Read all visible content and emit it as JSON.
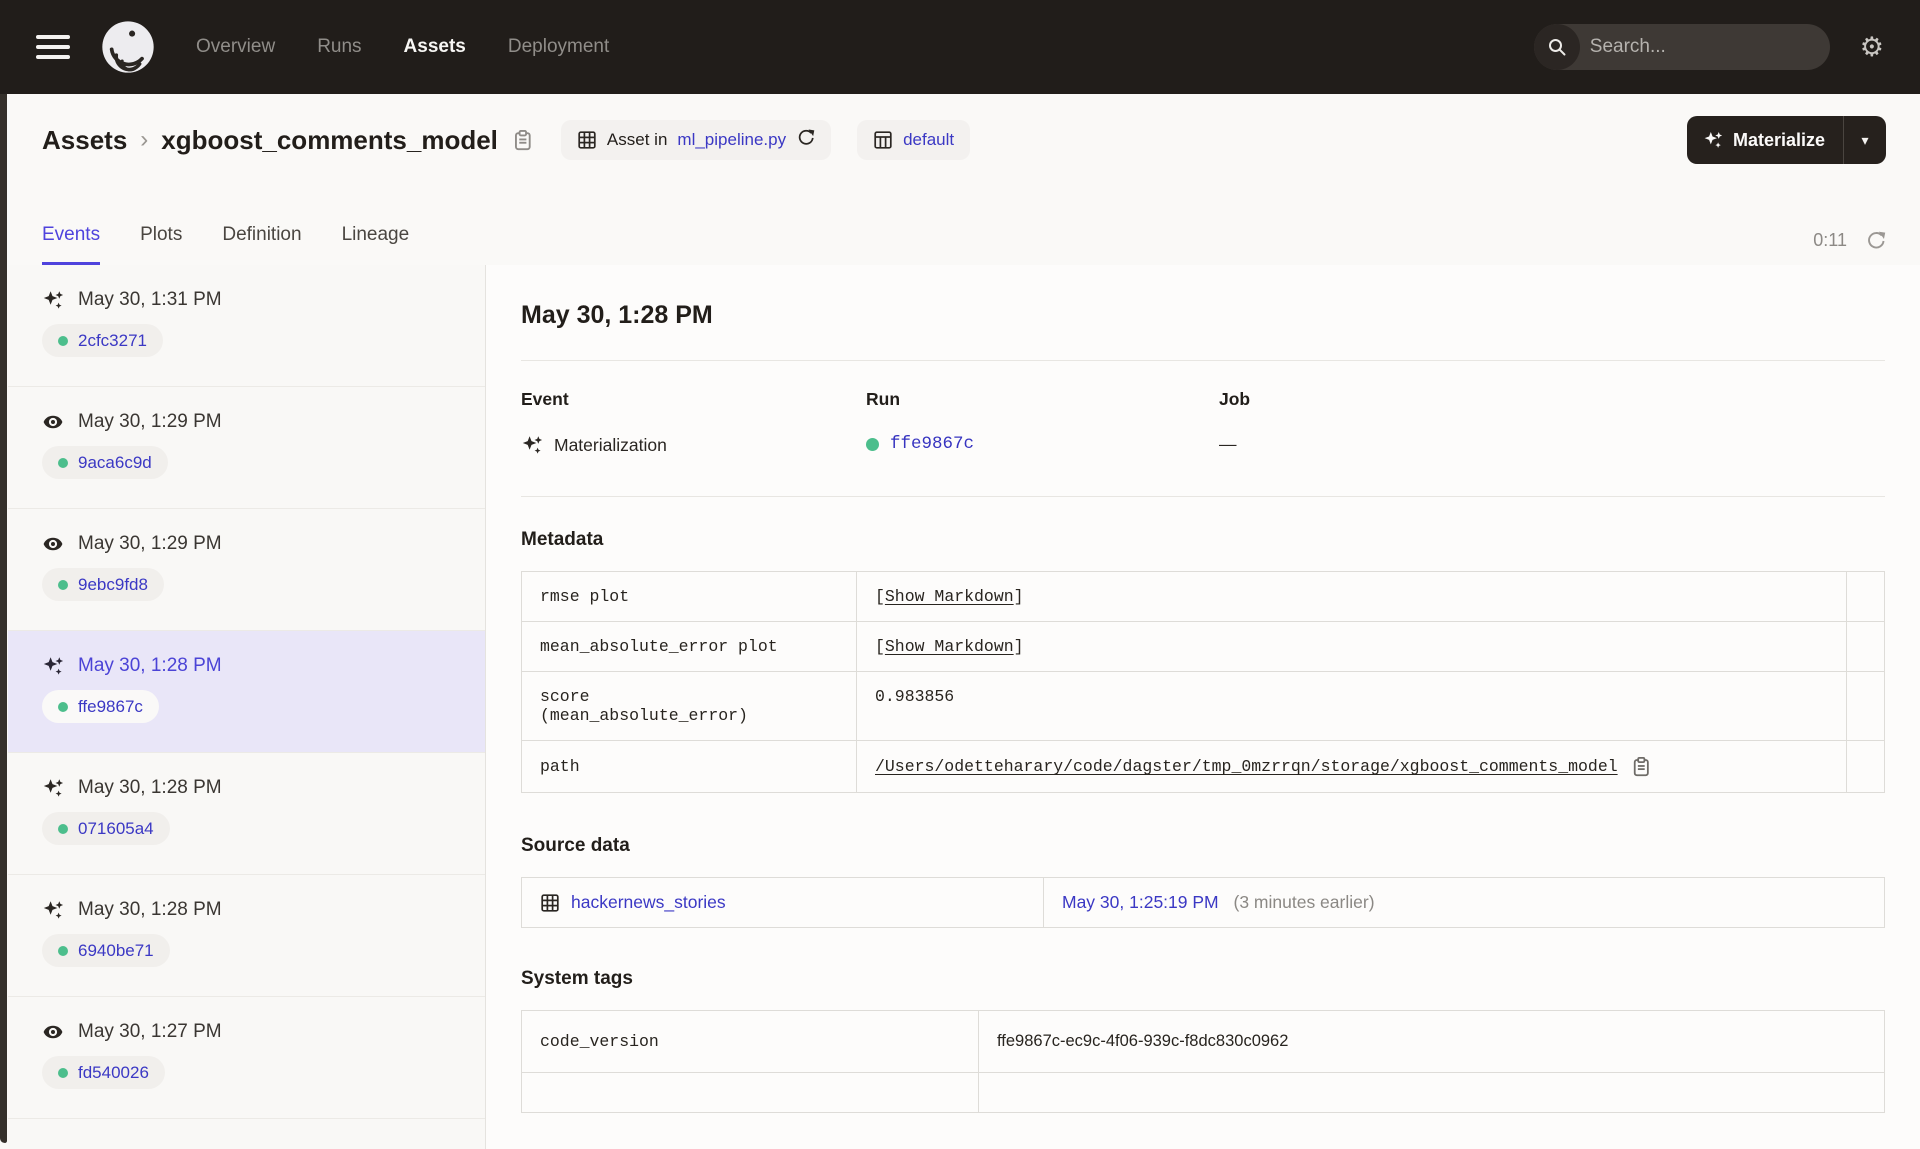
{
  "nav": {
    "items": [
      {
        "label": "Overview"
      },
      {
        "label": "Runs"
      },
      {
        "label": "Assets"
      },
      {
        "label": "Deployment"
      }
    ],
    "search": {
      "placeholder": "Search...",
      "shortcut": "/"
    }
  },
  "breadcrumb": {
    "root": "Assets",
    "separator": "›",
    "asset_name": "xgboost_comments_model"
  },
  "header_badges": {
    "asset_in_prefix": "Asset in",
    "asset_in_file": "ml_pipeline.py",
    "repo": "default"
  },
  "materialize": {
    "label": "Materialize",
    "caret": "▾"
  },
  "tabs": {
    "items": [
      {
        "label": "Events"
      },
      {
        "label": "Plots"
      },
      {
        "label": "Definition"
      },
      {
        "label": "Lineage"
      }
    ],
    "timer": "0:11"
  },
  "events": [
    {
      "type": "materialization",
      "time": "May 30, 1:31 PM",
      "run_id": "2cfc3271"
    },
    {
      "type": "observation",
      "time": "May 30, 1:29 PM",
      "run_id": "9aca6c9d"
    },
    {
      "type": "observation",
      "time": "May 30, 1:29 PM",
      "run_id": "9ebc9fd8"
    },
    {
      "type": "materialization",
      "time": "May 30, 1:28 PM",
      "run_id": "ffe9867c",
      "selected": true
    },
    {
      "type": "materialization",
      "time": "May 30, 1:28 PM",
      "run_id": "071605a4"
    },
    {
      "type": "materialization",
      "time": "May 30, 1:28 PM",
      "run_id": "6940be71"
    },
    {
      "type": "observation",
      "time": "May 30, 1:27 PM",
      "run_id": "fd540026"
    }
  ],
  "detail": {
    "title": "May 30, 1:28 PM",
    "event": {
      "label": "Event",
      "value": "Materialization"
    },
    "run": {
      "label": "Run",
      "value": "ffe9867c"
    },
    "job": {
      "label": "Job",
      "value": "—"
    },
    "metadata": {
      "heading": "Metadata",
      "rows": [
        {
          "key": "rmse plot",
          "open": "[",
          "link": "Show Markdown",
          "close": "]"
        },
        {
          "key": "mean_absolute_error plot",
          "open": "[",
          "link": "Show Markdown",
          "close": "]"
        },
        {
          "key": "score\n(mean_absolute_error)",
          "value": "0.983856"
        },
        {
          "key": "path",
          "path": "/Users/odetteharary/code/dagster/tmp_0mzrrqn/storage/xgboost_comments_model"
        }
      ]
    },
    "source_data": {
      "heading": "Source data",
      "asset": "hackernews_stories",
      "time": "May 30, 1:25:19 PM",
      "note": "(3 minutes earlier)"
    },
    "system_tags": {
      "heading": "System tags",
      "rows": [
        {
          "key": "code_version",
          "value": "ffe9867c-ec9c-4f06-939c-f8dc830c0962"
        }
      ]
    }
  },
  "colors": {
    "accent": "#4F43DD",
    "link": "#3B38C4",
    "success_green": "#4CBE8C",
    "nav_bg": "#211D1A"
  }
}
